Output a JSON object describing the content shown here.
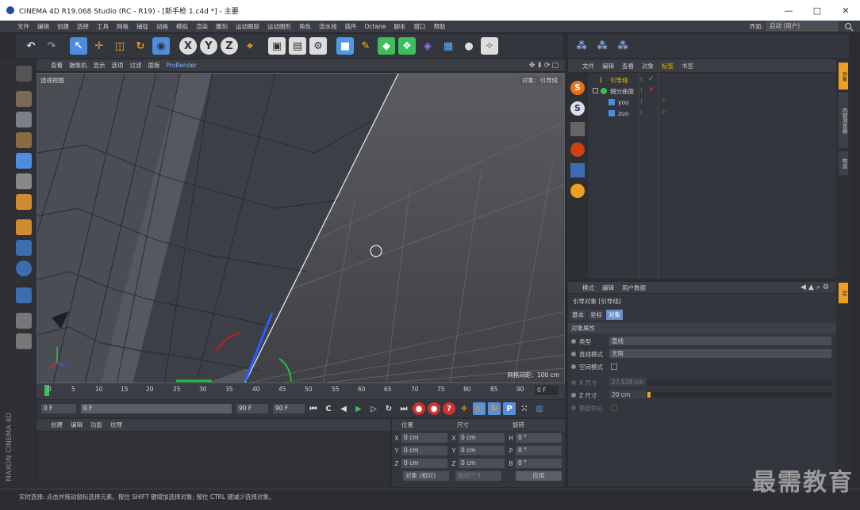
{
  "title": "CINEMA 4D R19.068 Studio (RC - R19) - [新手枪 1.c4d *] - 主要",
  "window_controls": [
    "—",
    "□",
    "✕"
  ],
  "menu": [
    "文件",
    "编辑",
    "创建",
    "选择",
    "工具",
    "网格",
    "捕捉",
    "动画",
    "模拟",
    "渲染",
    "雕刻",
    "运动跟踪",
    "运动图形",
    "角色",
    "流水线",
    "插件",
    "Octane",
    "脚本",
    "窗口",
    "帮助"
  ],
  "layout": {
    "label": "界面:",
    "value": "启动 (用户)"
  },
  "viewport": {
    "menu": [
      "查看",
      "摄像机",
      "显示",
      "选项",
      "过滤",
      "面板",
      "ProRender"
    ],
    "camera_label": "透视视图",
    "object_label": "对象：引导线",
    "grid_label": "网格间距：100 cm"
  },
  "timeline": {
    "ticks": [
      "0",
      "5",
      "10",
      "15",
      "20",
      "25",
      "30",
      "35",
      "40",
      "45",
      "50",
      "55",
      "60",
      "65",
      "70",
      "75",
      "80",
      "85",
      "90"
    ],
    "frame_readout": "0 F"
  },
  "playback": {
    "start": "0 F",
    "current": "0 F",
    "end": "90 F",
    "max": "90 F"
  },
  "material": {
    "menu": [
      "创建",
      "编辑",
      "功能",
      "纹理"
    ]
  },
  "brand": "MAXON CINEMA 4D",
  "coordinates": {
    "headers": [
      "位置",
      "尺寸",
      "旋转"
    ],
    "rows": [
      {
        "a": "X",
        "pos": "0 cm",
        "b": "X",
        "size": "0 cm",
        "c": "H",
        "rot": "0 °"
      },
      {
        "a": "Y",
        "pos": "0 cm",
        "b": "Y",
        "size": "0 cm",
        "c": "P",
        "rot": "0 °"
      },
      {
        "a": "Z",
        "pos": "0 cm",
        "b": "Z",
        "size": "0 cm",
        "c": "B",
        "rot": "0 °"
      }
    ],
    "mode": "对象 (相对)",
    "size_mode": "绝对尺寸",
    "apply": "应用"
  },
  "objects": {
    "menu": [
      "文件",
      "编辑",
      "查看",
      "对象",
      "标签",
      "书签"
    ],
    "active_menu_index": 4,
    "items": [
      {
        "name": "引导线",
        "indent": 0
      },
      {
        "name": "细分曲面",
        "indent": 0
      },
      {
        "name": "you",
        "indent": 1
      },
      {
        "name": "zuo",
        "indent": 1
      }
    ]
  },
  "attributes": {
    "menu": [
      "模式",
      "编辑",
      "用户数据"
    ],
    "object_title": "引导对象 [引导线]",
    "tabs": [
      "基本",
      "坐标",
      "对象"
    ],
    "active_tab": 2,
    "section": "对象属性",
    "rows": [
      {
        "label": "类型",
        "value": "直线",
        "kind": "select"
      },
      {
        "label": "直线模式",
        "value": "无限",
        "kind": "select"
      },
      {
        "label": "空间模式",
        "value": "",
        "kind": "check"
      },
      {
        "label": "X 尺寸",
        "value": "27.518 cm",
        "kind": "number",
        "dim": true
      },
      {
        "label": "Z 尺寸",
        "value": "20 cm",
        "kind": "number",
        "dim": false
      },
      {
        "label": "锁定中心",
        "value": "",
        "kind": "check",
        "dim": true
      }
    ]
  },
  "side_tabs": [
    "对象",
    "内容浏览器",
    "构造",
    "层"
  ],
  "status": "实时选择: 点击并拖动鼠标选择元素。按住 SHIFT 键增加选择对象; 按住 CTRL 键减少选择对象。",
  "watermark": "最需教育"
}
